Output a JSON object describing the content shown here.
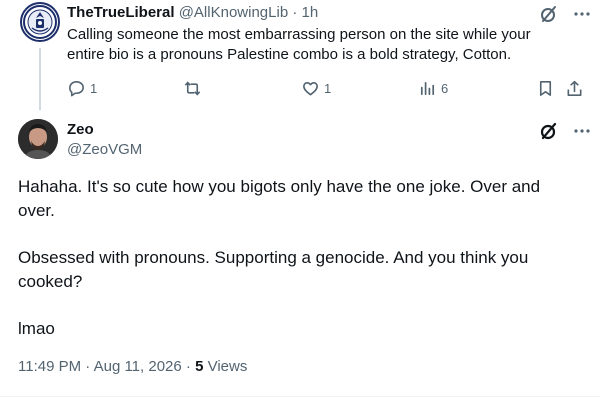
{
  "parent_tweet": {
    "display_name": "TheTrueLiberal",
    "handle": "@AllKnowingLib",
    "separator": "·",
    "time": "1h",
    "text": "Calling someone the most embarrassing person on the site while your entire bio is a pronouns Palestine combo is a bold strategy, Cotton.",
    "replies": "1",
    "retweets": "",
    "likes": "1",
    "views": "6"
  },
  "reply": {
    "display_name": "Zeo",
    "handle": "@ZeoVGM",
    "paragraphs": [
      "Hahaha. It's so cute how you bigots only have the one joke. Over and over.",
      "Obsessed with pronouns. Supporting a genocide. And you think you cooked?",
      "lmao"
    ],
    "timestamp": "11:49 PM · Aug 11, 2026",
    "dot": "·",
    "views_count": "5",
    "views_label": "Views"
  },
  "icons": {
    "grok": "grok-icon",
    "more": "more-options-icon",
    "reply": "reply-icon",
    "retweet": "retweet-icon",
    "like": "like-icon",
    "analytics": "analytics-icon",
    "bookmark": "bookmark-icon",
    "share": "share-icon"
  },
  "colors": {
    "text": "#0f1419",
    "muted": "#536471",
    "thread_line": "#cfd9de",
    "avatar_border": "#1d2f6b"
  }
}
